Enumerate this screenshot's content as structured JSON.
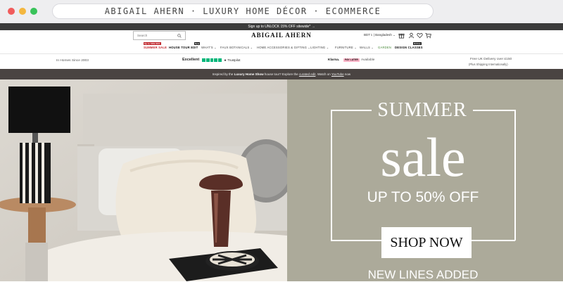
{
  "browser": {
    "url_text": "ABIGAIL AHERN · LUXURY HOME DÉCOR · ECOMMERCE"
  },
  "promo_bar": {
    "text": "Sign up to UNLOCK 15% OFF sitewide* →"
  },
  "header": {
    "search_placeholder": "Search",
    "logo": "ABIGAIL AHERN",
    "locale": "BDT ৳ | Bangladesh ⌄"
  },
  "nav": {
    "items": [
      {
        "label": "SUMMER SALE",
        "badge": "Up to 50% OFF"
      },
      {
        "label": "HOUSE TOUR EDIT",
        "badge": "New"
      },
      {
        "label": "WHAT'S ⌄",
        "badge": ""
      },
      {
        "label": "FAUX BOTANICALS ⌄",
        "badge": ""
      },
      {
        "label": "HOME ACCESSORIES & GIFTING ⌄",
        "badge": ""
      },
      {
        "label": "LIGHTING ⌄",
        "badge": ""
      },
      {
        "label": "FURNITURE ⌄",
        "badge": ""
      },
      {
        "label": "WALLS ⌄",
        "badge": ""
      },
      {
        "label": "GARDEN",
        "badge": ""
      },
      {
        "label": "DESIGN CLASSES",
        "badge": "Online"
      }
    ]
  },
  "usp": {
    "in_homes": "In Homes Since 2003",
    "trustpilot_rating": "Excellent",
    "trustpilot_label": "★ Trustpilot",
    "klarna_label": "Klarna.",
    "klarna_badge": "PAY LATER",
    "klarna_available": "Available",
    "delivery_line1": "Free UK Delivery over £150",
    "delivery_line2": "(Plus Shipping Internationally)"
  },
  "info_bar": {
    "prefix": "Inspired by the",
    "bold1": "Luxury Home Show",
    "middle": "house tour? Explore the",
    "link1": "curated edit",
    "middle2": ". Watch on",
    "link2": "YouTube",
    "suffix": "now"
  },
  "hero": {
    "heading": "SUMMER",
    "title": "sale",
    "subtitle": "UP TO 50% OFF",
    "cta": "SHOP NOW",
    "footer": "NEW LINES ADDED"
  },
  "colors": {
    "hero_panel": "#acaa9a",
    "info_bar": "#4a4442",
    "sale_red": "#c0272d",
    "trustpilot_green": "#00b67a"
  }
}
